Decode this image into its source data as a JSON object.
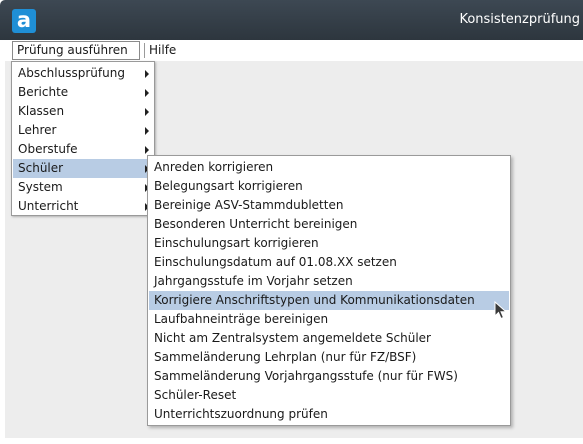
{
  "window": {
    "title": "Konsistenzprüfung",
    "logo_letter": "a"
  },
  "menubar": {
    "items": [
      {
        "label": "Prüfung ausführen",
        "open": true
      },
      {
        "label": "Hilfe",
        "open": false
      }
    ]
  },
  "dropdown": {
    "items": [
      {
        "label": "Abschlussprüfung",
        "has_submenu": true,
        "active": false
      },
      {
        "label": "Berichte",
        "has_submenu": true,
        "active": false
      },
      {
        "label": "Klassen",
        "has_submenu": true,
        "active": false
      },
      {
        "label": "Lehrer",
        "has_submenu": true,
        "active": false
      },
      {
        "label": "Oberstufe",
        "has_submenu": true,
        "active": false
      },
      {
        "label": "Schüler",
        "has_submenu": true,
        "active": true
      },
      {
        "label": "System",
        "has_submenu": true,
        "active": false
      },
      {
        "label": "Unterricht",
        "has_submenu": true,
        "active": false
      }
    ]
  },
  "submenu": {
    "items": [
      {
        "label": "Anreden korrigieren",
        "active": false
      },
      {
        "label": "Belegungsart korrigieren",
        "active": false
      },
      {
        "label": "Bereinige ASV-Stammdubletten",
        "active": false
      },
      {
        "label": "Besonderen Unterricht bereinigen",
        "active": false
      },
      {
        "label": "Einschulungsart korrigieren",
        "active": false
      },
      {
        "label": "Einschulungsdatum auf 01.08.XX setzen",
        "active": false
      },
      {
        "label": "Jahrgangsstufe im Vorjahr setzen",
        "active": false
      },
      {
        "label": "Korrigiere Anschriftstypen und Kommunikationsdaten",
        "active": true
      },
      {
        "label": "Laufbahneinträge bereinigen",
        "active": false
      },
      {
        "label": "Nicht am Zentralsystem angemeldete Schüler",
        "active": false
      },
      {
        "label": "Sammeländerung Lehrplan (nur für FZ/BSF)",
        "active": false
      },
      {
        "label": "Sammeländerung Vorjahrgangsstufe (nur für FWS)",
        "active": false
      },
      {
        "label": "Schüler-Reset",
        "active": false
      },
      {
        "label": "Unterrichtszuordnung prüfen",
        "active": false
      }
    ]
  },
  "colors": {
    "titlebar": "#2f3942",
    "logo": "#1f8fd6",
    "highlight": "#b8cce4",
    "workspace": "#ededed"
  }
}
